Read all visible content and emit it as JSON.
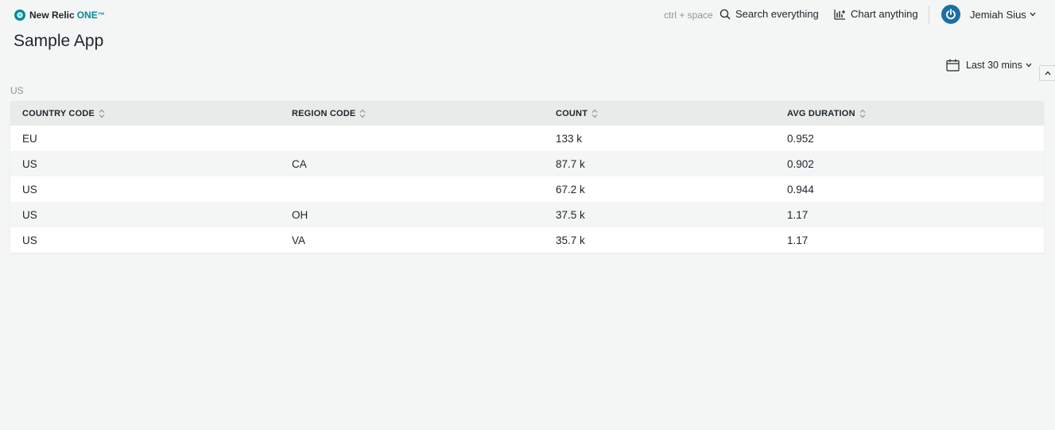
{
  "brand": {
    "name": "New Relic",
    "product": "ONE",
    "tm": "™"
  },
  "header": {
    "shortcut": "ctrl + space",
    "search_label": "Search everything",
    "chart_label": "Chart anything",
    "user_name": "Jemiah Sius"
  },
  "page": {
    "title": "Sample App",
    "time_range": "Last 30 mins"
  },
  "widget": {
    "label": "US",
    "columns": [
      "COUNTRY CODE",
      "REGION CODE",
      "COUNT",
      "AVG DURATION"
    ],
    "rows": [
      {
        "country": "EU",
        "region": "",
        "count": "133 k",
        "avg_duration": "0.952"
      },
      {
        "country": "US",
        "region": "CA",
        "count": "87.7 k",
        "avg_duration": "0.902"
      },
      {
        "country": "US",
        "region": "",
        "count": "67.2 k",
        "avg_duration": "0.944"
      },
      {
        "country": "US",
        "region": "OH",
        "count": "37.5 k",
        "avg_duration": "1.17"
      },
      {
        "country": "US",
        "region": "VA",
        "count": "35.7 k",
        "avg_duration": "1.17"
      }
    ]
  },
  "colors": {
    "accent": "#008c99",
    "avatar": "#1b6fa3",
    "background": "#f4f5f5"
  }
}
